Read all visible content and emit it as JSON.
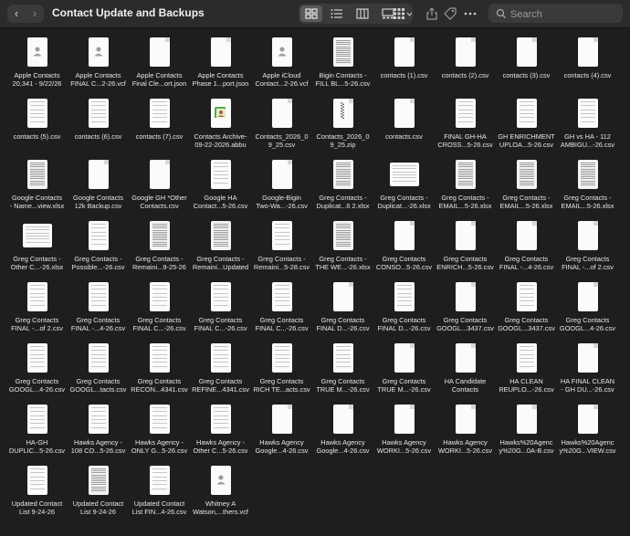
{
  "window": {
    "title": "Contact Update and Backups"
  },
  "toolbar": {
    "back_label": "‹",
    "forward_label": "›",
    "view_modes": [
      "icon-view",
      "list-view",
      "column-view",
      "gallery-view"
    ],
    "search_placeholder": "Search"
  },
  "files": [
    {
      "name": "Apple Contacts\n20,341 - 9/22/26",
      "kind": "card"
    },
    {
      "name": "Apple Contacts\nFINAL C...2-26.vcf",
      "kind": "card"
    },
    {
      "name": "Apple Contacts\nFinal Cle...ort.json",
      "kind": "blank"
    },
    {
      "name": "Apple Contacts\nPhase 1...port.json",
      "kind": "blank"
    },
    {
      "name": "Apple iCloud\nContact...2-26.vcf",
      "kind": "card"
    },
    {
      "name": "Bigin Contacts -\nFILL BL...5-26.csv",
      "kind": "dense"
    },
    {
      "name": "contacts (1).csv",
      "kind": "blank"
    },
    {
      "name": "contacts (2).csv",
      "kind": "blank"
    },
    {
      "name": "contacts (3).csv",
      "kind": "blank"
    },
    {
      "name": "contacts (4).csv",
      "kind": "blank"
    },
    {
      "name": "contacts (5).csv",
      "kind": "lines"
    },
    {
      "name": "contacts (6).csv",
      "kind": "lines"
    },
    {
      "name": "contacts (7).csv",
      "kind": "lines"
    },
    {
      "name": "Contacts Archive-\n09-22-2026.abbu",
      "kind": "archive"
    },
    {
      "name": "Contacts_2026_0\n9_25.csv",
      "kind": "blank"
    },
    {
      "name": "Contacts_2026_0\n9_25.zip",
      "kind": "zip"
    },
    {
      "name": "contacts.csv",
      "kind": "blank"
    },
    {
      "name": "FINAL GH-HA\nCROSS...5-26.csv",
      "kind": "lines"
    },
    {
      "name": "GH ENRICHMENT\nUPLOA...5-26.csv",
      "kind": "lines"
    },
    {
      "name": "GH vs HA - 112\nAMBIGU...-26.csv",
      "kind": "lines"
    },
    {
      "name": "Google Contacts\n- Name...view.xlsx",
      "kind": "sheet"
    },
    {
      "name": "Google Contacts\n12k Backup.csv",
      "kind": "blank"
    },
    {
      "name": "Google GH *Other\nContacts.csv",
      "kind": "blank"
    },
    {
      "name": "Google HA\nContact...5-26.csv",
      "kind": "lines"
    },
    {
      "name": "Google-Bigin\nTwo-Wa...-26.csv",
      "kind": "blank"
    },
    {
      "name": "Greg Contacts -\nDuplicat...6 2.xlsx",
      "kind": "sheet"
    },
    {
      "name": "Greg Contacts -\nDuplicat...-26.xlsx",
      "kind": "wide"
    },
    {
      "name": "Greg Contacts -\nEMAIL...5-26.xlsx",
      "kind": "sheet"
    },
    {
      "name": "Greg Contacts -\nEMAIL...5-26.xlsx",
      "kind": "sheet"
    },
    {
      "name": "Greg Contacts -\nEMAIL...5-26.xlsx",
      "kind": "sheet"
    },
    {
      "name": "Greg Contacts -\nOther C...-26.xlsx",
      "kind": "wide"
    },
    {
      "name": "Greg Contacts -\nPossible...-26.csv",
      "kind": "lines"
    },
    {
      "name": "Greg Contacts -\nRemaini...9-25-26",
      "kind": "dense"
    },
    {
      "name": "Greg Contacts -\nRemaini...Updated",
      "kind": "dense"
    },
    {
      "name": "Greg Contacts -\nRemaini...5-28.csv",
      "kind": "lines"
    },
    {
      "name": "Greg Contacts -\nTHE WE...-26.xlsx",
      "kind": "sheet"
    },
    {
      "name": "Greg Contacts\nCONSO...5-26.csv",
      "kind": "blank"
    },
    {
      "name": "Greg Contacts\nENRICH...5-26.csv",
      "kind": "blank"
    },
    {
      "name": "Greg Contacts\nFINAL -...4-26.csv",
      "kind": "blank"
    },
    {
      "name": "Greg Contacts\nFINAL -...of 2.csv",
      "kind": "blank"
    },
    {
      "name": "Greg Contacts\nFINAL -...of 2.csv",
      "kind": "lines"
    },
    {
      "name": "Greg Contacts\nFINAL -...4-26.csv",
      "kind": "lines"
    },
    {
      "name": "Greg Contacts\nFINAL C...-26.csv",
      "kind": "lines"
    },
    {
      "name": "Greg Contacts\nFINAL C...-26.csv",
      "kind": "lines"
    },
    {
      "name": "Greg Contacts\nFINAL C...-26.csv",
      "kind": "lines"
    },
    {
      "name": "Greg Contacts\nFINAL D...-26.csv",
      "kind": "blank"
    },
    {
      "name": "Greg Contacts\nFINAL D...-26.csv",
      "kind": "lines"
    },
    {
      "name": "Greg Contacts\nGOOGL...3437.csv",
      "kind": "blank"
    },
    {
      "name": "Greg Contacts\nGOOGL...3437.csv",
      "kind": "lines"
    },
    {
      "name": "Greg Contacts\nGOOGL...4-26.csv",
      "kind": "blank"
    },
    {
      "name": "Greg Contacts\nGOOGL...4-26.csv",
      "kind": "lines"
    },
    {
      "name": "Greg Contacts\nGOOGL...tacts.csv",
      "kind": "lines"
    },
    {
      "name": "Greg Contacts\nRECON...4341.csv",
      "kind": "lines"
    },
    {
      "name": "Greg Contacts\nREFINE...4341.csv",
      "kind": "lines"
    },
    {
      "name": "Greg Contacts\nRICH TE...acts.csv",
      "kind": "lines"
    },
    {
      "name": "Greg Contacts\nTRUE M...-26.csv",
      "kind": "lines"
    },
    {
      "name": "Greg Contacts\nTRUE M...-26.csv",
      "kind": "blank"
    },
    {
      "name": "HA Candidate\nContacts",
      "kind": "blank"
    },
    {
      "name": "HA CLEAN\nREUPLO...-26.csv",
      "kind": "lines"
    },
    {
      "name": "HA FINAL CLEAN\n- GH DU...-26.csv",
      "kind": "blank"
    },
    {
      "name": "HA-GH\nDUPLIC...5-26.csv",
      "kind": "lines"
    },
    {
      "name": "Hawks Agency -\n108 CO...5-26.csv",
      "kind": "lines"
    },
    {
      "name": "Hawks Agency -\nONLY G...5-26.csv",
      "kind": "lines"
    },
    {
      "name": "Hawks Agency -\nOther C...5-26.csv",
      "kind": "lines"
    },
    {
      "name": "Hawks Agency\nGoogle...4-26.csv",
      "kind": "blank"
    },
    {
      "name": "Hawks Agency\nGoogle...4-26.csv",
      "kind": "blank"
    },
    {
      "name": "Hawks Agency\nWORKI...5-26.csv",
      "kind": "blank"
    },
    {
      "name": "Hawks Agency\nWORKI...5-26.csv",
      "kind": "blank"
    },
    {
      "name": "Hawks%20Agenc\ny%20G...0A-B.csv",
      "kind": "blank"
    },
    {
      "name": "Hawks%20Agenc\ny%20G...VIEW.csv",
      "kind": "blank"
    },
    {
      "name": "Updated Contact\nList 9-24-26",
      "kind": "lines"
    },
    {
      "name": "Updated Contact\nList 9-24-26",
      "kind": "dense"
    },
    {
      "name": "Updated Contact\nList FIN...4-26.csv",
      "kind": "lines"
    },
    {
      "name": "Whitney A\nWatson,...thers.vcf",
      "kind": "card"
    }
  ]
}
